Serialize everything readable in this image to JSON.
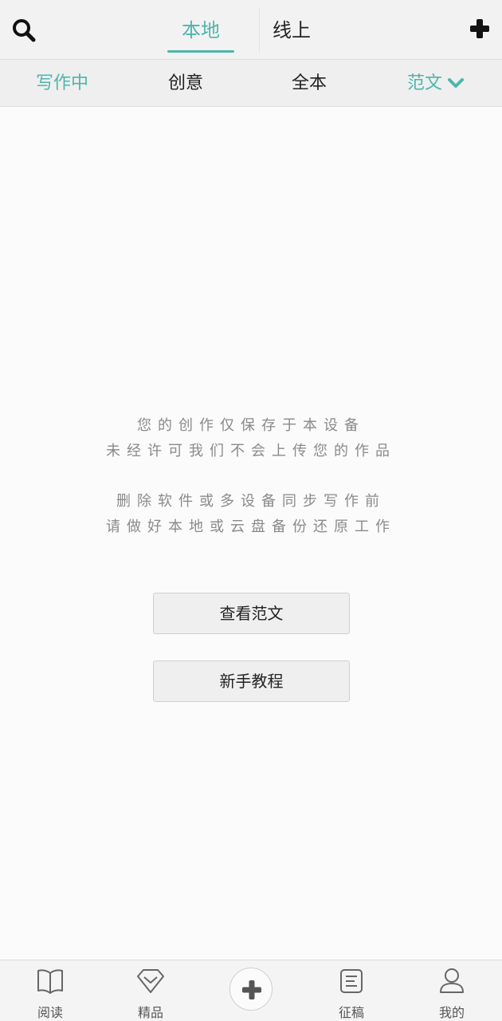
{
  "header": {
    "tabs": [
      {
        "label": "本地",
        "active": true
      },
      {
        "label": "线上",
        "active": false
      }
    ],
    "search_icon": "search-icon",
    "add_icon": "plus-icon"
  },
  "filters": {
    "items": [
      {
        "label": "写作中",
        "active": true
      },
      {
        "label": "创意",
        "active": false
      },
      {
        "label": "全本",
        "active": false
      },
      {
        "label": "范文",
        "active": true,
        "icon": "chevron-down-icon"
      }
    ]
  },
  "message": {
    "line1": "您的创作仅保存于本设备",
    "line2": "未经许可我们不会上传您的作品",
    "line3": "删除软件或多设备同步写作前",
    "line4": "请做好本地或云盘备份还原工作"
  },
  "actions": {
    "view_samples": "查看范文",
    "tutorial": "新手教程"
  },
  "bottom_nav": {
    "items": [
      {
        "label": "阅读",
        "icon": "book-icon"
      },
      {
        "label": "精品",
        "icon": "diamond-icon"
      },
      {
        "label": "",
        "icon": "plus-icon"
      },
      {
        "label": "征稿",
        "icon": "document-icon"
      },
      {
        "label": "我的",
        "icon": "user-icon"
      }
    ]
  },
  "colors": {
    "accent": "#4db6ac",
    "background": "#fbfbfb",
    "bar": "#f2f2f2"
  }
}
